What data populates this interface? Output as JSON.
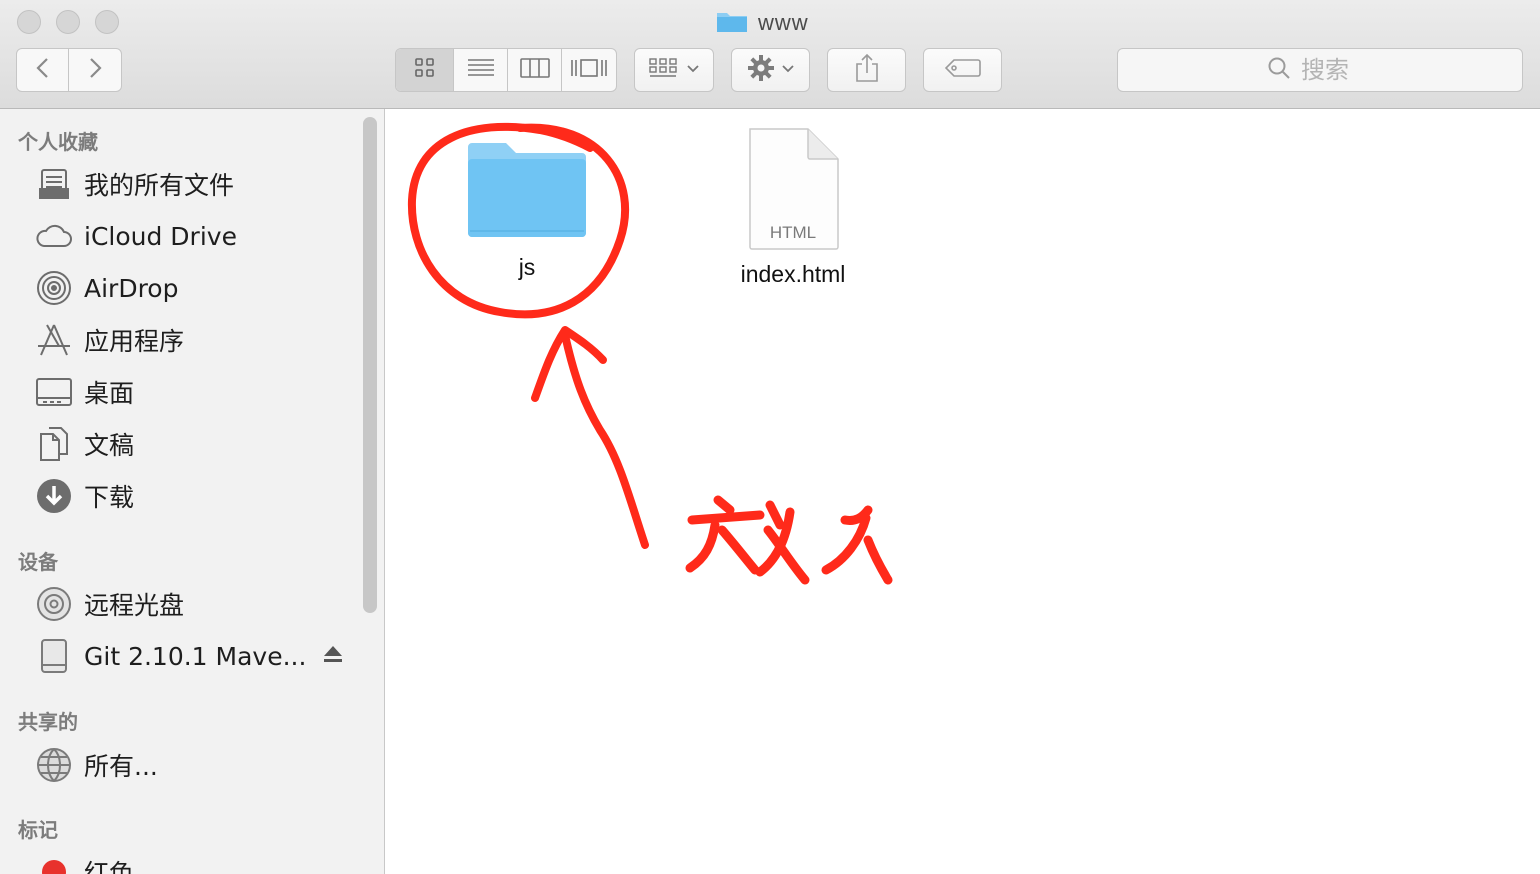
{
  "window": {
    "title": "www",
    "folder_icon": "folder-icon",
    "traffic_lights": [
      "#d6d6d6",
      "#d6d6d6",
      "#d6d6d6"
    ]
  },
  "toolbar": {
    "back_icon": "chevron-left-icon",
    "forward_icon": "chevron-right-icon",
    "view_modes": [
      "icon-view-icon",
      "list-view-icon",
      "column-view-icon",
      "cover-flow-icon"
    ],
    "active_view": "icon-view-icon",
    "arrange_icon": "arrange-grid-icon",
    "action_icon": "gear-icon",
    "share_icon": "share-icon",
    "tag_icon": "tag-icon",
    "search_placeholder": "搜索"
  },
  "sidebar": {
    "favorites_title": "个人收藏",
    "favorites": [
      {
        "label": "我的所有文件",
        "icon": "all-files-icon"
      },
      {
        "label": "iCloud Drive",
        "icon": "cloud-icon"
      },
      {
        "label": "AirDrop",
        "icon": "airdrop-icon"
      },
      {
        "label": "应用程序",
        "icon": "applications-icon"
      },
      {
        "label": "桌面",
        "icon": "desktop-icon"
      },
      {
        "label": "文稿",
        "icon": "documents-icon"
      },
      {
        "label": "下载",
        "icon": "download-icon"
      }
    ],
    "devices_title": "设备",
    "devices": [
      {
        "label": "远程光盘",
        "icon": "disc-icon"
      },
      {
        "label": "Git 2.10.1 Mave...",
        "icon": "drive-icon"
      }
    ],
    "shared_title": "共享的",
    "shared": [
      {
        "label": "所有...",
        "icon": "network-icon"
      }
    ],
    "tags_title": "标记",
    "tags": [
      {
        "label": "红色",
        "icon": "red-tag-icon",
        "color": "#e8322d"
      }
    ]
  },
  "content": {
    "files": [
      {
        "name": "js",
        "type": "folder",
        "icon": "folder-icon"
      },
      {
        "name": "index.html",
        "type": "html",
        "icon": "html-file-icon",
        "badge": "HTML"
      }
    ],
    "annotation": {
      "text": "放入",
      "color": "#ff2a1a"
    }
  }
}
